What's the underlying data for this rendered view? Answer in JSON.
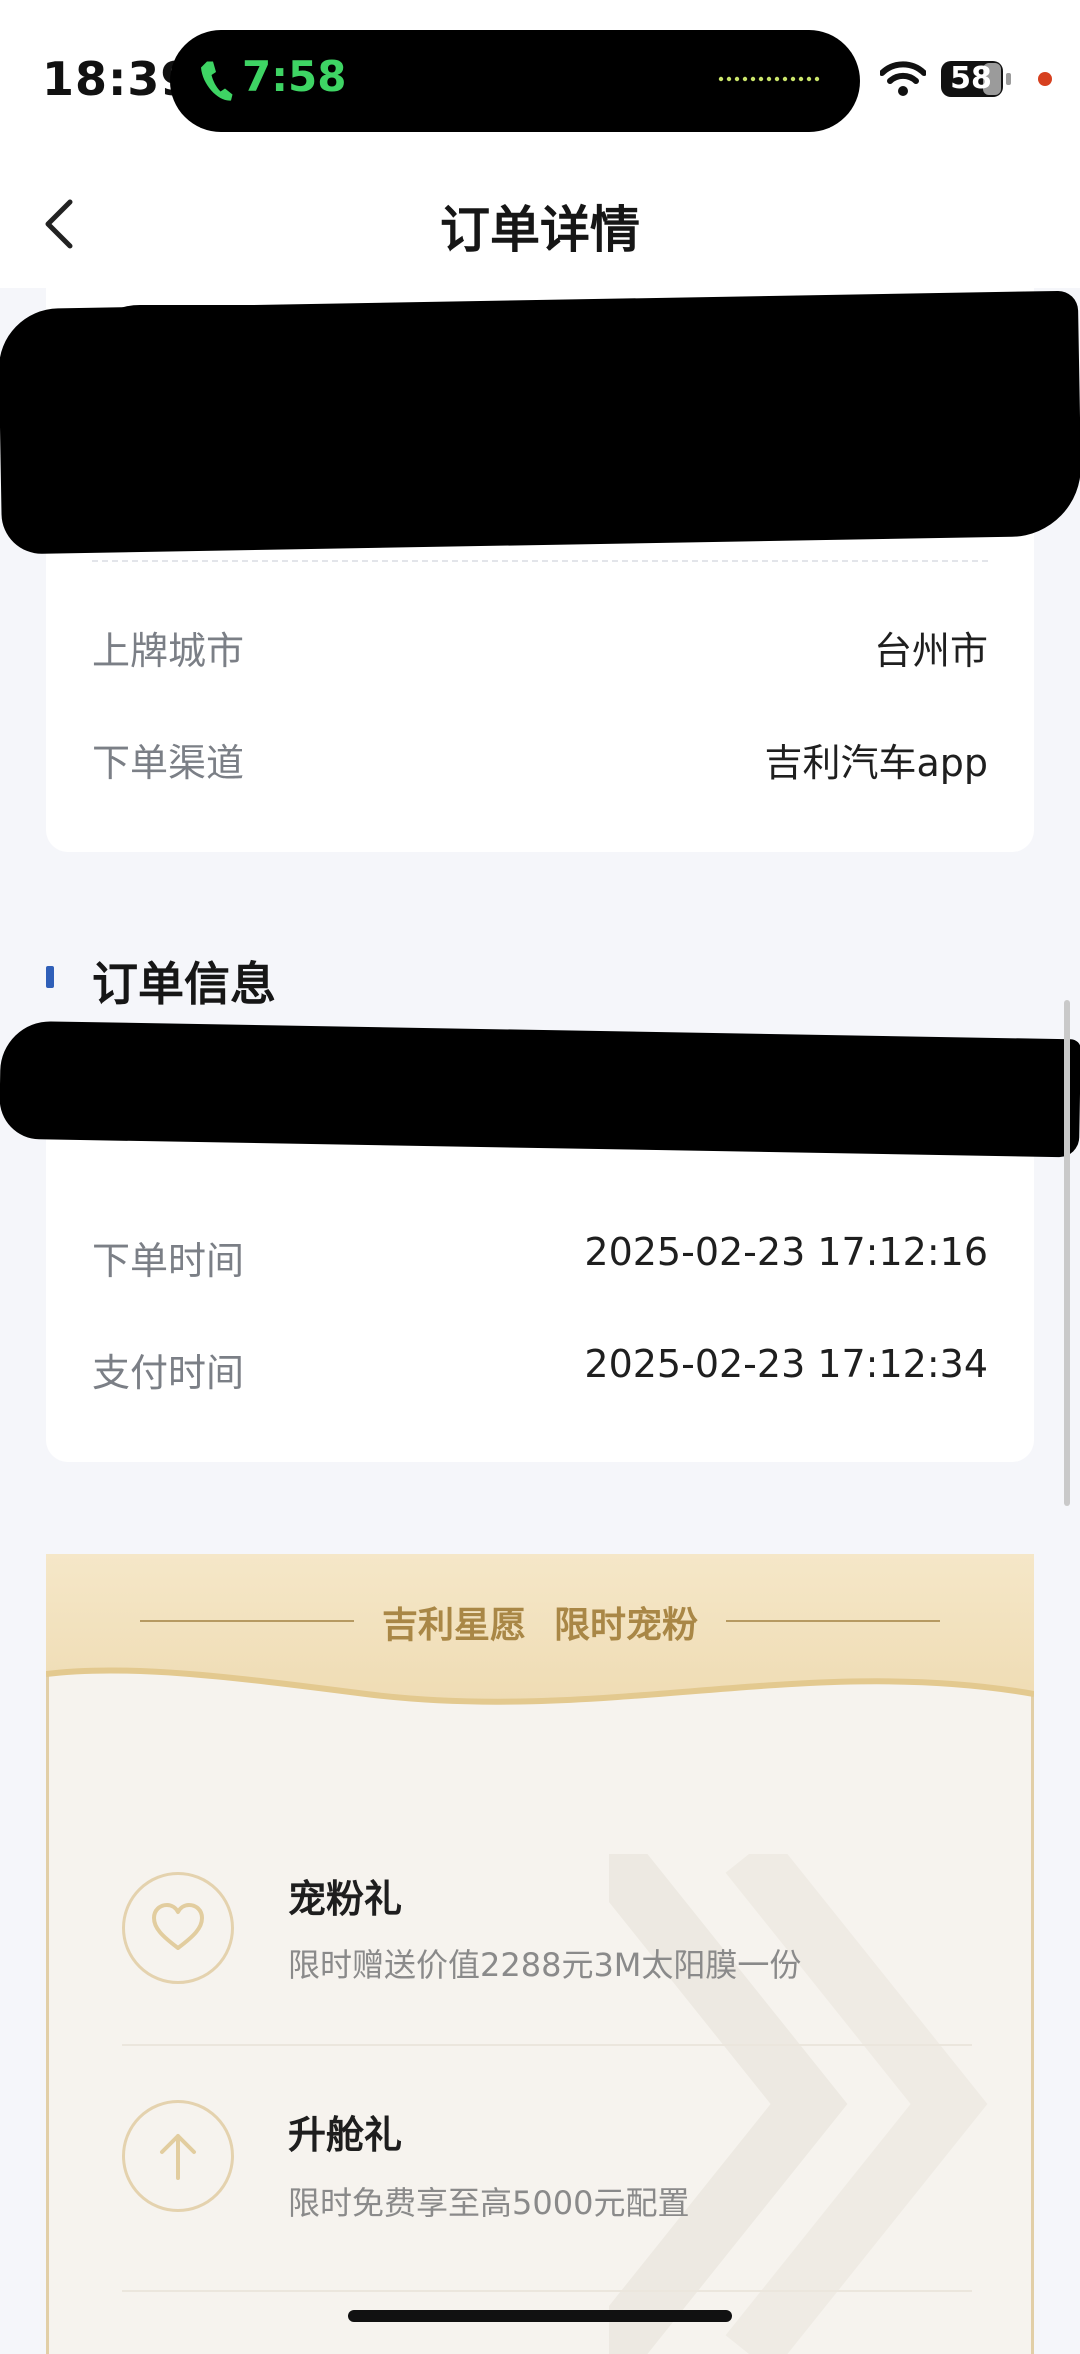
{
  "status_bar": {
    "time": "18:39",
    "call_timer": "7:58",
    "battery": "58",
    "icons": [
      "phone-icon",
      "wifi-icon",
      "battery-icon",
      "recording-dot"
    ],
    "call_color": "#3ed464"
  },
  "nav": {
    "title": "订单详情",
    "back_icon": "chevron-left-icon"
  },
  "vehicle_card": {
    "rows": [
      {
        "label": "上牌城市",
        "value": "台州市"
      },
      {
        "label": "下单渠道",
        "value": "吉利汽车app"
      }
    ]
  },
  "order_section": {
    "title": "订单信息",
    "accent": "#2f5fb8",
    "rows": [
      {
        "label": "下单时间",
        "value": "2025-02-23 17:12:16"
      },
      {
        "label": "支付时间",
        "value": "2025-02-23 17:12:34"
      }
    ]
  },
  "promo": {
    "title_left": "吉利星愿",
    "title_right": "限时宠粉",
    "accent": "#a98746",
    "gifts": [
      {
        "icon": "heart-icon",
        "title": "宠粉礼",
        "desc": "限时赠送价值2288元3M太阳膜一份"
      },
      {
        "icon": "arrow-up-icon",
        "title": "升舱礼",
        "desc": "限时免费享至高5000元配置"
      }
    ]
  }
}
